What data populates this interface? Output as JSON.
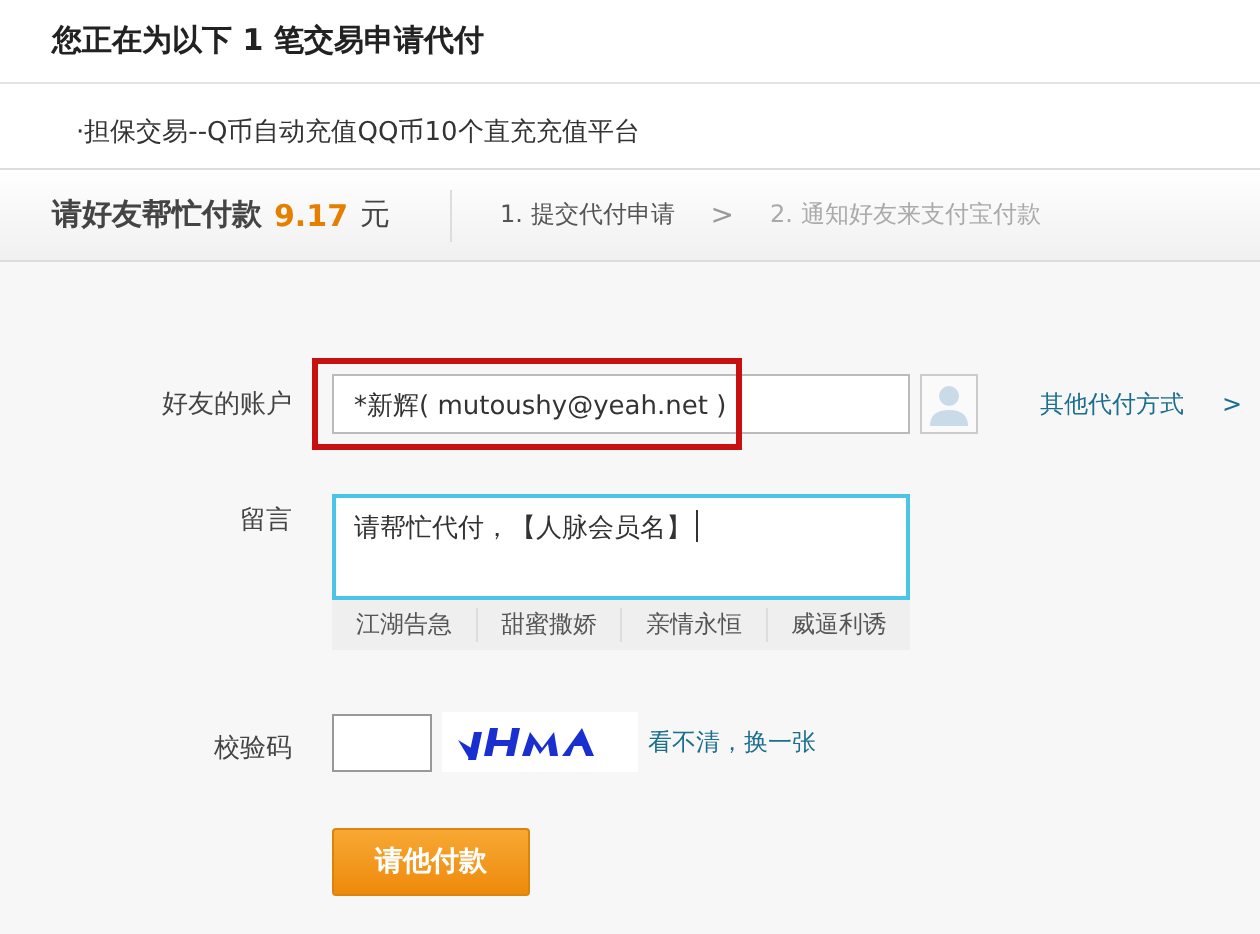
{
  "header": {
    "title": "您正在为以下 1 笔交易申请代付"
  },
  "items": [
    "·担保交易--Q币自动充值QQ币10个直充充值平台"
  ],
  "summary": {
    "label": "请好友帮忙付款",
    "amount": "9.17",
    "unit": "元"
  },
  "steps": [
    {
      "label": "1. 提交代付申请",
      "active": true
    },
    {
      "label": "2. 通知好友来支付宝付款",
      "active": false
    }
  ],
  "step_separator": ">",
  "form": {
    "account": {
      "label": "好友的账户",
      "value": "*新辉( mutoushy@yeah.net )",
      "highlighted": true
    },
    "other_link": "其他代付方式",
    "other_link_arrow": ">",
    "message": {
      "label": "留言",
      "value": "请帮忙代付，【人脉会员名】"
    },
    "phrases": [
      "江湖告急",
      "甜蜜撒娇",
      "亲情永恒",
      "威逼利诱"
    ],
    "captcha": {
      "label": "校验码",
      "refresh_link": "看不清，换一张"
    },
    "submit": "请他付款"
  }
}
